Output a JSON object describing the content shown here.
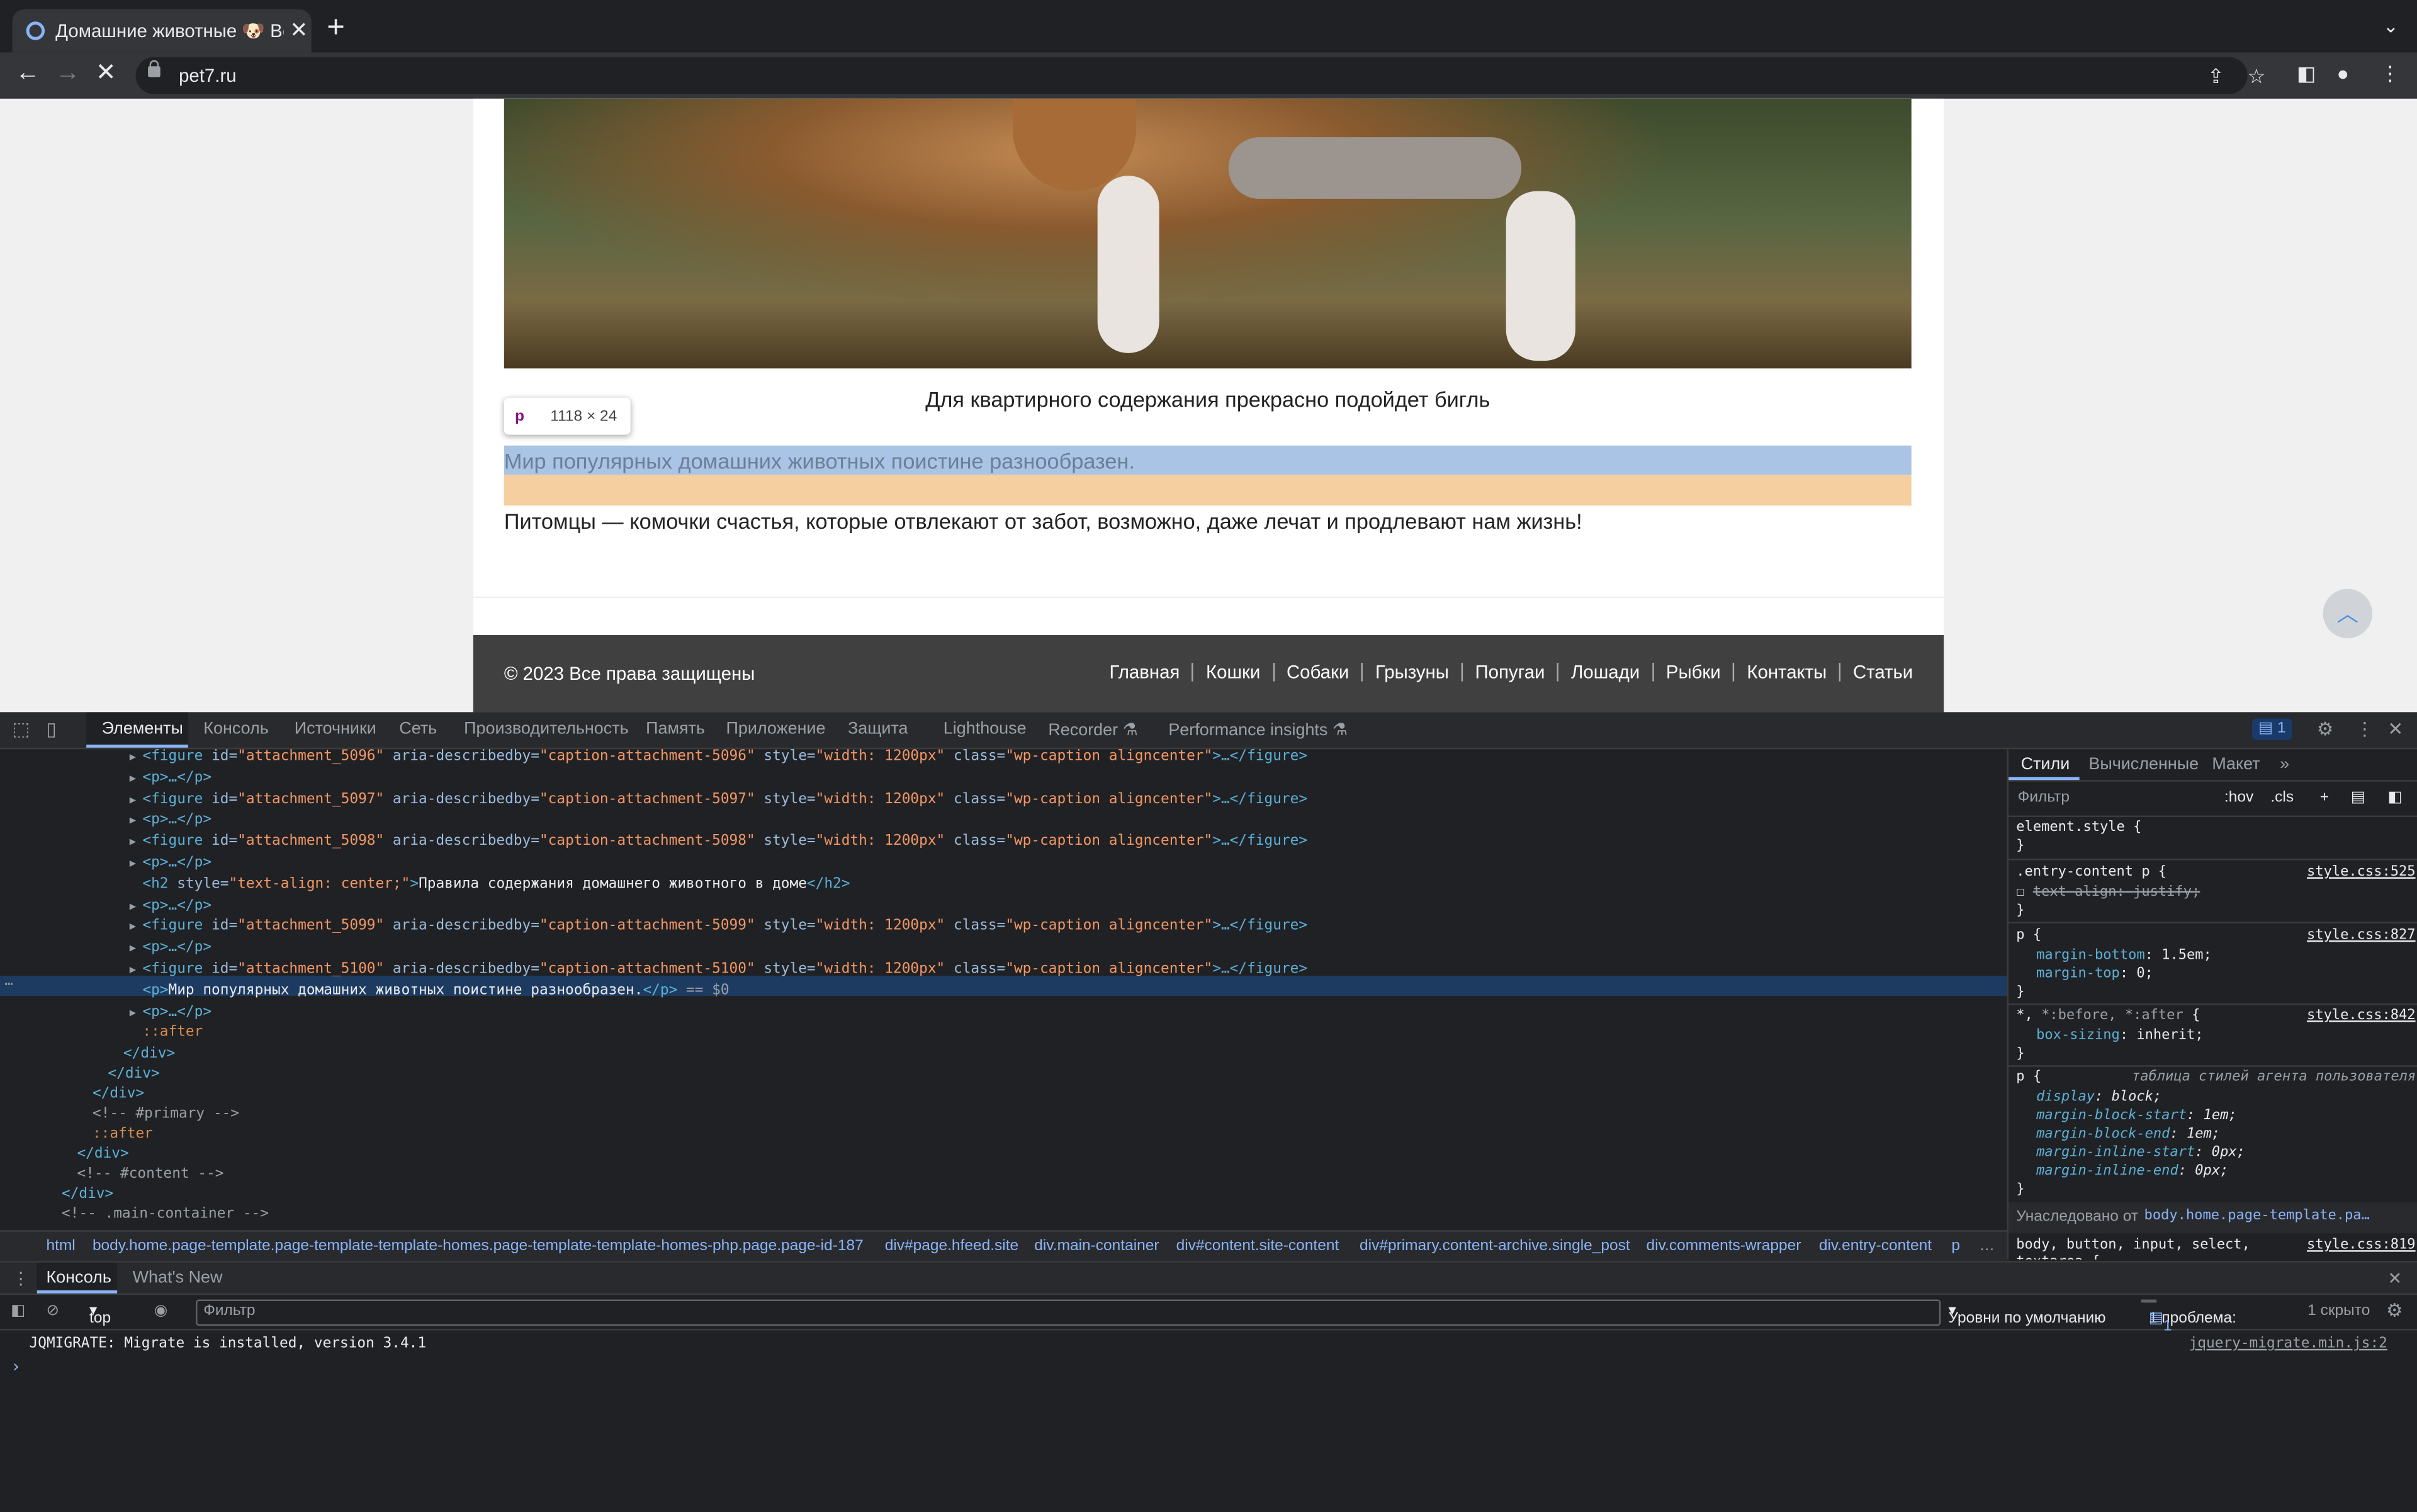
{
  "browser": {
    "tab_title": "Домашние животные 🐶 Все о",
    "url": "pet7.ru"
  },
  "page": {
    "caption": "Для квартирного содержания прекрасно подойдет бигль",
    "highlighted_paragraph": "Мир популярных домашних животных поистине разнообразен.",
    "paragraph2": "Питомцы — комочки счастья, которые отвлекают от забот, возможно, даже лечат и продлевают нам жизнь!",
    "tooltip_tag": "p",
    "tooltip_dims": "1118 × 24",
    "footer_copyright": "© 2023 Все права защищены",
    "footer_menu": [
      "Главная",
      "Кошки",
      "Собаки",
      "Грызуны",
      "Попугаи",
      "Лошади",
      "Рыбки",
      "Контакты",
      "Статьи"
    ]
  },
  "devtools": {
    "tabs": [
      "Элементы",
      "Консоль",
      "Источники",
      "Сеть",
      "Производительность",
      "Память",
      "Приложение",
      "Защита",
      "Lighthouse",
      "Recorder ⚗",
      "Performance insights ⚗"
    ],
    "issues_count": "1",
    "dom": [
      {
        "indent": "▶",
        "parts": [
          [
            "t-tag",
            "<figure "
          ],
          [
            "t-attr",
            "id="
          ],
          [
            "t-val",
            "\"attachment_5096\""
          ],
          [
            "t-attr",
            " aria-describedby="
          ],
          [
            "t-val",
            "\"caption-attachment-5096\""
          ],
          [
            "t-attr",
            " style="
          ],
          [
            "t-val",
            "\"width: 1200px\""
          ],
          [
            "t-attr",
            " class="
          ],
          [
            "t-val",
            "\"wp-caption aligncenter\""
          ],
          [
            "t-tag",
            ">…</figure>"
          ]
        ]
      },
      {
        "indent": "▶",
        "parts": [
          [
            "t-tag",
            "<p>…</p>"
          ]
        ]
      },
      {
        "indent": "▶",
        "parts": [
          [
            "t-tag",
            "<figure "
          ],
          [
            "t-attr",
            "id="
          ],
          [
            "t-val",
            "\"attachment_5097\""
          ],
          [
            "t-attr",
            " aria-describedby="
          ],
          [
            "t-val",
            "\"caption-attachment-5097\""
          ],
          [
            "t-attr",
            " style="
          ],
          [
            "t-val",
            "\"width: 1200px\""
          ],
          [
            "t-attr",
            " class="
          ],
          [
            "t-val",
            "\"wp-caption aligncenter\""
          ],
          [
            "t-tag",
            ">…</figure>"
          ]
        ]
      },
      {
        "indent": "▶",
        "parts": [
          [
            "t-tag",
            "<p>…</p>"
          ]
        ]
      },
      {
        "indent": "▶",
        "parts": [
          [
            "t-tag",
            "<figure "
          ],
          [
            "t-attr",
            "id="
          ],
          [
            "t-val",
            "\"attachment_5098\""
          ],
          [
            "t-attr",
            " aria-describedby="
          ],
          [
            "t-val",
            "\"caption-attachment-5098\""
          ],
          [
            "t-attr",
            " style="
          ],
          [
            "t-val",
            "\"width: 1200px\""
          ],
          [
            "t-attr",
            " class="
          ],
          [
            "t-val",
            "\"wp-caption aligncenter\""
          ],
          [
            "t-tag",
            ">…</figure>"
          ]
        ]
      },
      {
        "indent": "▶",
        "parts": [
          [
            "t-tag",
            "<p>…</p>"
          ]
        ]
      },
      {
        "indent": " ",
        "parts": [
          [
            "t-tag",
            "<h2 "
          ],
          [
            "t-attr",
            "style="
          ],
          [
            "t-val",
            "\"text-align: center;\""
          ],
          [
            "t-tag",
            ">"
          ],
          [
            "t-txt",
            "Правила содержания домашнего животного в доме"
          ],
          [
            "t-tag",
            "</h2>"
          ]
        ]
      },
      {
        "indent": "▶",
        "parts": [
          [
            "t-tag",
            "<p>…</p>"
          ]
        ]
      },
      {
        "indent": "▶",
        "parts": [
          [
            "t-tag",
            "<figure "
          ],
          [
            "t-attr",
            "id="
          ],
          [
            "t-val",
            "\"attachment_5099\""
          ],
          [
            "t-attr",
            " aria-describedby="
          ],
          [
            "t-val",
            "\"caption-attachment-5099\""
          ],
          [
            "t-attr",
            " style="
          ],
          [
            "t-val",
            "\"width: 1200px\""
          ],
          [
            "t-attr",
            " class="
          ],
          [
            "t-val",
            "\"wp-caption aligncenter\""
          ],
          [
            "t-tag",
            ">…</figure>"
          ]
        ]
      },
      {
        "indent": "▶",
        "parts": [
          [
            "t-tag",
            "<p>…</p>"
          ]
        ]
      },
      {
        "indent": "▶",
        "parts": [
          [
            "t-tag",
            "<figure "
          ],
          [
            "t-attr",
            "id="
          ],
          [
            "t-val",
            "\"attachment_5100\""
          ],
          [
            "t-attr",
            " aria-describedby="
          ],
          [
            "t-val",
            "\"caption-attachment-5100\""
          ],
          [
            "t-attr",
            " style="
          ],
          [
            "t-val",
            "\"width: 1200px\""
          ],
          [
            "t-attr",
            " class="
          ],
          [
            "t-val",
            "\"wp-caption aligncenter\""
          ],
          [
            "t-tag",
            ">…</figure>"
          ]
        ]
      },
      {
        "indent": " ",
        "parts": [
          [
            "t-tag",
            "<p>"
          ],
          [
            "t-txt",
            "Мир популярных домашних животных поистине разнообразен."
          ],
          [
            "t-tag",
            "</p>"
          ],
          [
            "t-cmt",
            " == $0"
          ]
        ]
      },
      {
        "indent": "▶",
        "parts": [
          [
            "t-tag",
            "<p>…</p>"
          ]
        ]
      },
      {
        "indent": " ",
        "parts": [
          [
            "t-pseudo",
            "::after"
          ]
        ]
      }
    ],
    "dom_tail": [
      {
        "level": 0,
        "text": "</div>",
        "cls": "t-tag"
      },
      {
        "level": 1,
        "text": "</div>",
        "cls": "t-tag"
      },
      {
        "level": 2,
        "text": "</div>",
        "cls": "t-tag"
      },
      {
        "level": 2,
        "text": "<!-- #primary -->",
        "cls": "t-cmt"
      },
      {
        "level": 2,
        "text": "::after",
        "cls": "t-pseudo"
      },
      {
        "level": 3,
        "text": "</div>",
        "cls": "t-tag"
      },
      {
        "level": 3,
        "text": "<!-- #content -->",
        "cls": "t-cmt"
      },
      {
        "level": 4,
        "text": "</div>",
        "cls": "t-tag"
      },
      {
        "level": 4,
        "text": "<!-- .main-container -->",
        "cls": "t-cmt"
      }
    ],
    "breadcrumbs": [
      "html",
      "body.home.page-template.page-template-template-homes.page-template-template-homes-php.page.page-id-187",
      "div#page.hfeed.site",
      "div.main-container",
      "div#content.site-content",
      "div#primary.content-archive.single_post",
      "div.comments-wrapper",
      "div.entry-content",
      "p"
    ],
    "styles": {
      "tabs": [
        "Стили",
        "Вычисленные",
        "Макет"
      ],
      "filter_placeholder": "Фильтр",
      "hov": ":hov",
      "cls": ".cls",
      "inherited_label": "Унаследовано от",
      "inherited_from": "body.home.page-template.pa…"
    },
    "console": {
      "tabs": [
        "Консоль",
        "What's New"
      ],
      "context": "top",
      "filter_placeholder": "Фильтр",
      "levels": "Уровни по умолчанию",
      "problems": "1 проблема:",
      "problems_count": "1",
      "hidden": "1 скрыто",
      "log_message": "JQMIGRATE: Migrate is installed, version 3.4.1",
      "log_source": "jquery-migrate.min.js:2"
    }
  }
}
